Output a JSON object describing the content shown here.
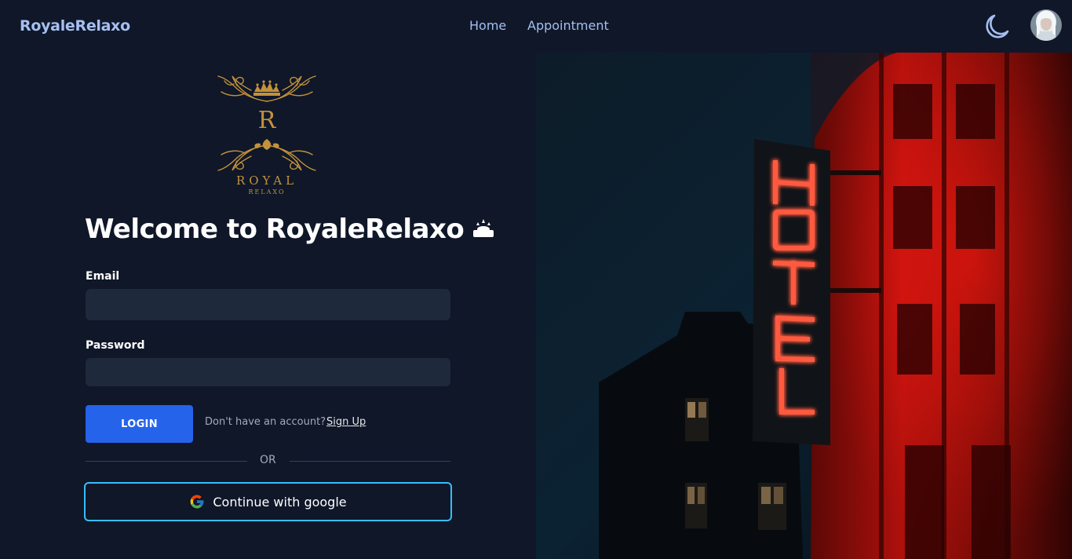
{
  "nav": {
    "brand": "RoyaleRelaxo",
    "links": [
      {
        "label": "Home"
      },
      {
        "label": "Appointment"
      }
    ]
  },
  "logo": {
    "letter": "R",
    "word": "ROYAL",
    "sub": "RELAXO",
    "color": "#c4923a"
  },
  "form": {
    "title": "Welcome to RoyaleRelaxo",
    "email_label": "Email",
    "email_value": "",
    "password_label": "Password",
    "password_value": "",
    "login_label": "LOGIN",
    "no_account_text": "Don't have an account?",
    "signup_label": "Sign Up",
    "or_text": "OR",
    "google_label": "Continue with google"
  },
  "hero": {
    "sign_letters": [
      "H",
      "O",
      "T",
      "E",
      "L"
    ],
    "neon_color": "#ff2a1f"
  },
  "colors": {
    "background": "#0f1729",
    "input_bg": "#1e293b",
    "primary": "#2563eb",
    "google_border": "#38bdf8",
    "brand_text": "#a6bff0"
  }
}
